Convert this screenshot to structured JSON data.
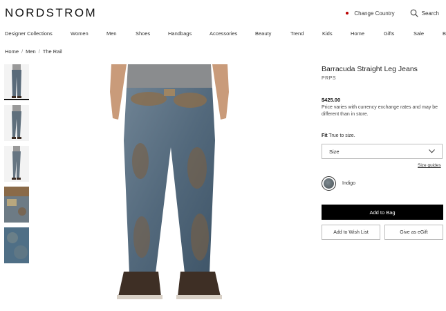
{
  "header": {
    "logo": "NORDSTROM",
    "change_country": "Change Country",
    "search": "Search",
    "accent": "#b00000"
  },
  "nav": {
    "items": [
      "Designer Collections",
      "Women",
      "Men",
      "Shoes",
      "Handbags",
      "Accessories",
      "Beauty",
      "Trend",
      "Kids",
      "Home",
      "Gifts",
      "Sale",
      "B"
    ]
  },
  "breadcrumb": [
    "Home",
    "Men",
    "The Rail"
  ],
  "product": {
    "title": "Barracuda Straight Leg Jeans",
    "brand": "PRPS",
    "price": "$425.00",
    "price_note": "Price varies with currency exchange rates and may be different than in store.",
    "fit_label": "Fit",
    "fit_value": "True to size.",
    "size_placeholder": "Size",
    "size_guides": "Size guides",
    "color": "Indigo",
    "add_to_bag": "Add to Bag",
    "add_to_wish_list": "Add to Wish List",
    "give_as_egift": "Give as eGift"
  }
}
